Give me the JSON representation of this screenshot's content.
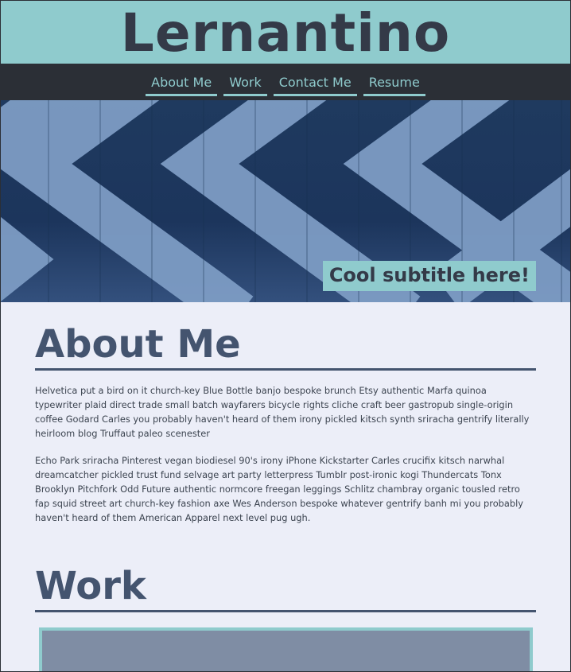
{
  "site": {
    "title": "Lernantino"
  },
  "nav": {
    "items": [
      {
        "label": "About Me"
      },
      {
        "label": "Work"
      },
      {
        "label": "Contact Me"
      },
      {
        "label": "Resume"
      }
    ]
  },
  "hero": {
    "subtitle": "Cool subtitle here!"
  },
  "about": {
    "heading": "About Me",
    "paragraphs": [
      "Helvetica put a bird on it church-key Blue Bottle banjo bespoke brunch Etsy authentic Marfa quinoa typewriter plaid direct trade small batch wayfarers bicycle rights cliche craft beer gastropub single-origin coffee Godard Carles you probably haven't heard of them irony pickled kitsch synth sriracha gentrify literally heirloom blog Truffaut paleo scenester",
      "Echo Park sriracha Pinterest vegan biodiesel 90's irony iPhone Kickstarter Carles crucifix kitsch narwhal dreamcatcher pickled trust fund selvage art party letterpress Tumblr post-ironic kogi Thundercats Tonx Brooklyn Pitchfork Odd Future authentic normcore freegan leggings Schlitz chambray organic tousled retro fap squid street art church-key fashion axe Wes Anderson bespoke whatever gentrify banh mi you probably haven't heard of them American Apparel next level pug ugh."
    ]
  },
  "work": {
    "heading": "Work"
  },
  "colors": {
    "header_bg": "#8fcbcd",
    "nav_bg": "#2b2f36",
    "accent": "#8fcbcd",
    "heading": "#44546f",
    "page_bg": "#eceef8"
  }
}
